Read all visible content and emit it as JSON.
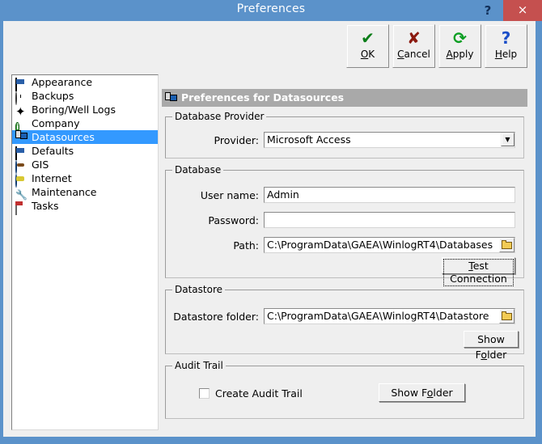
{
  "window": {
    "title": "Preferences",
    "help_icon": "?",
    "close_icon": "×"
  },
  "toolbar": {
    "buttons": [
      {
        "name": "ok",
        "icon": "✔",
        "label_pre": "",
        "accel": "O",
        "label_post": "K"
      },
      {
        "name": "cancel",
        "icon": "✘",
        "label_pre": "",
        "accel": "C",
        "label_post": "ancel"
      },
      {
        "name": "apply",
        "icon": "⟳",
        "label_pre": "",
        "accel": "A",
        "label_post": "pply"
      },
      {
        "name": "help",
        "icon": "?",
        "label_pre": "",
        "accel": "H",
        "label_post": "elp"
      }
    ]
  },
  "sidebar": {
    "items": [
      {
        "label": "Appearance",
        "icon": "monitor-icon",
        "selected": false
      },
      {
        "label": "Backups",
        "icon": "clock-icon",
        "selected": false
      },
      {
        "label": "Boring/Well Logs",
        "icon": "star-icon",
        "selected": false
      },
      {
        "label": "Company",
        "icon": "info-icon",
        "selected": false
      },
      {
        "label": "Datasources",
        "icon": "database-icon",
        "selected": true
      },
      {
        "label": "Defaults",
        "icon": "monitor-icon",
        "selected": false
      },
      {
        "label": "GIS",
        "icon": "globe-icon",
        "selected": false
      },
      {
        "label": "Internet",
        "icon": "globe-web-icon",
        "selected": false
      },
      {
        "label": "Maintenance",
        "icon": "wrench-icon",
        "selected": false
      },
      {
        "label": "Tasks",
        "icon": "tasks-icon",
        "selected": false
      }
    ]
  },
  "panel": {
    "header": "Preferences for Datasources",
    "provider_group": {
      "title": "Database Provider",
      "provider_label": "Provider:",
      "provider_value": "Microsoft Access",
      "dropdown_arrow": "▼"
    },
    "database_group": {
      "title": "Database",
      "username_label": "User name:",
      "username_value": "Admin",
      "password_label": "Password:",
      "password_value": "",
      "path_label": "Path:",
      "path_value": "C:\\ProgramData\\GAEA\\WinlogRT4\\Databases",
      "test_connection_pre": "",
      "test_connection_accel": "T",
      "test_connection_post": "est Connection"
    },
    "datastore_group": {
      "title": "Datastore",
      "folder_label": "Datastore folder:",
      "folder_value": "C:\\ProgramData\\GAEA\\WinlogRT4\\Datastore",
      "show_folder_pre": "Show F",
      "show_folder_accel": "o",
      "show_folder_post": "lder"
    },
    "audit_group": {
      "title": "Audit Trail",
      "checkbox_label": "Create Audit Trail",
      "checkbox_checked": false,
      "show_folder_pre": "Show F",
      "show_folder_accel": "o",
      "show_folder_post": "lder"
    }
  },
  "colors": {
    "titlebar": "#5b92ca",
    "close": "#c5504f",
    "selection": "#3399ff",
    "header_gray": "#a9a9a9",
    "dialog": "#efefef"
  }
}
